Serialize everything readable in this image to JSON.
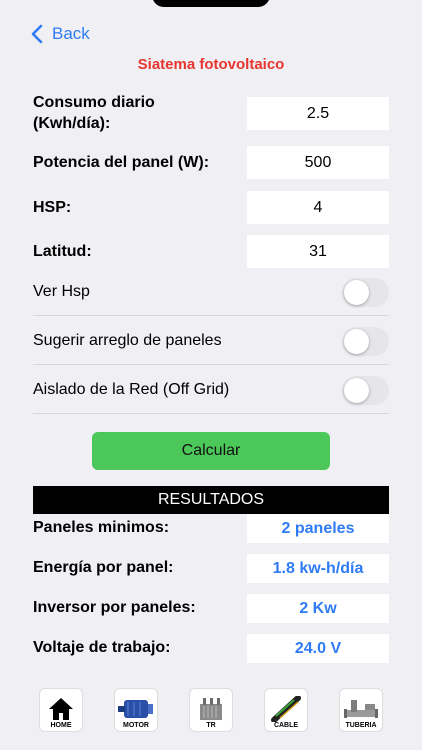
{
  "nav": {
    "back_label": "Back"
  },
  "title": "Siatema fotovoltaico",
  "inputs": [
    {
      "label_line1": "Consumo diario",
      "label_line2": "(Kwh/día):",
      "value": "2.5"
    },
    {
      "label": "Potencia del panel (W):",
      "value": "500"
    },
    {
      "label": "HSP:",
      "value": "4"
    },
    {
      "label": "Latitud:",
      "value": "31"
    }
  ],
  "toggles": [
    {
      "label": "Ver Hsp",
      "on": false
    },
    {
      "label": "Sugerir arreglo de paneles",
      "on": false
    },
    {
      "label": "Aislado de la Red (Off Grid)",
      "on": false
    }
  ],
  "calc_button": "Calcular",
  "results_header": "RESULTADOS",
  "results": [
    {
      "label": "Paneles minimos:",
      "value": "2 paneles"
    },
    {
      "label": "Energía por panel:",
      "value": "1.8 kw-h/día"
    },
    {
      "label": "Inversor por paneles:",
      "value": "2 Kw"
    },
    {
      "label": "Voltaje de trabajo:",
      "value": "24.0 V"
    }
  ],
  "tabbar": [
    {
      "label": "HOME",
      "icon": "house-icon"
    },
    {
      "label": "MOTOR",
      "icon": "motor-icon"
    },
    {
      "label": "TR",
      "icon": "transformer-icon"
    },
    {
      "label": "CABLE",
      "icon": "cable-icon"
    },
    {
      "label": "TUBERIA",
      "icon": "pipe-icon"
    }
  ],
  "colors": {
    "accent": "#2f7bf5",
    "title": "#e8352f",
    "button": "#4cc75a"
  }
}
